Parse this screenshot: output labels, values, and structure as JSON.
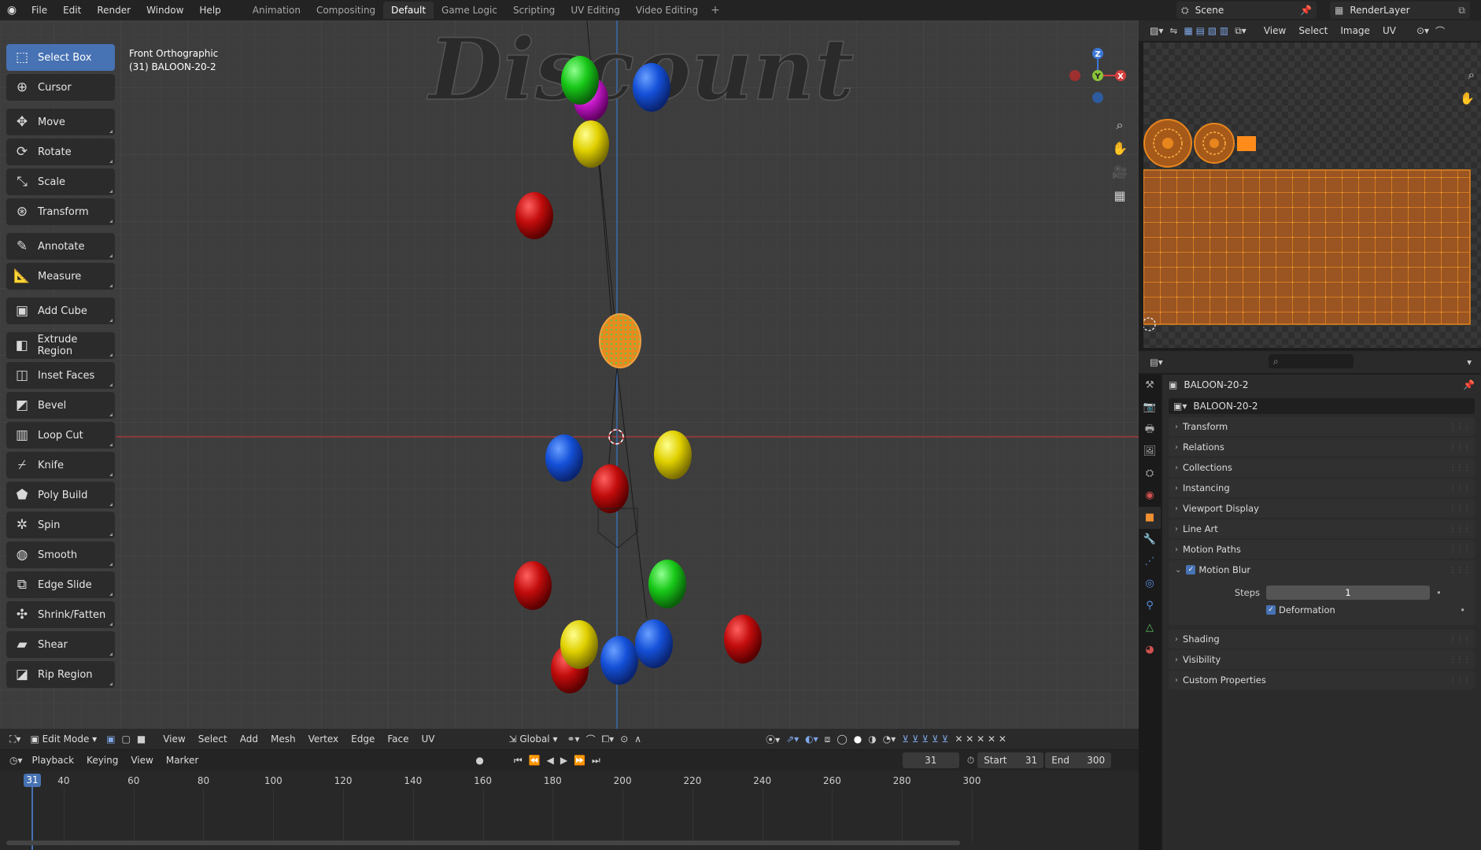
{
  "topbar": {
    "menus": [
      "File",
      "Edit",
      "Render",
      "Window",
      "Help"
    ],
    "workspaces": [
      {
        "label": "Animation",
        "active": false
      },
      {
        "label": "Compositing",
        "active": false
      },
      {
        "label": "Default",
        "active": true
      },
      {
        "label": "Game Logic",
        "active": false
      },
      {
        "label": "Scripting",
        "active": false
      },
      {
        "label": "UV Editing",
        "active": false
      },
      {
        "label": "Video Editing",
        "active": false
      }
    ],
    "add_workspace": "+",
    "scene": "Scene",
    "render_layer": "RenderLayer"
  },
  "viewport": {
    "view_name": "Front Orthographic",
    "object_info": "(31) BALOON-20-2",
    "background_text": "Discount",
    "gizmo": {
      "z": "Z",
      "y": "Y",
      "x": "X"
    }
  },
  "tools": [
    {
      "label": "Select Box",
      "icon": "select-box-icon",
      "glyph": "⬚",
      "active": true
    },
    {
      "label": "Cursor",
      "icon": "cursor-icon",
      "glyph": "⊕",
      "active": false
    },
    {
      "label": "Move",
      "icon": "move-icon",
      "glyph": "✥",
      "active": false
    },
    {
      "label": "Rotate",
      "icon": "rotate-icon",
      "glyph": "⟳",
      "active": false
    },
    {
      "label": "Scale",
      "icon": "scale-icon",
      "glyph": "⤡",
      "active": false
    },
    {
      "label": "Transform",
      "icon": "transform-icon",
      "glyph": "⊛",
      "active": false
    },
    {
      "label": "Annotate",
      "icon": "annotate-icon",
      "glyph": "✎",
      "active": false
    },
    {
      "label": "Measure",
      "icon": "measure-icon",
      "glyph": "📐",
      "active": false
    },
    {
      "label": "Add Cube",
      "icon": "add-cube-icon",
      "glyph": "▣",
      "active": false
    },
    {
      "label": "Extrude Region",
      "icon": "extrude-region-icon",
      "glyph": "◧",
      "active": false
    },
    {
      "label": "Inset Faces",
      "icon": "inset-faces-icon",
      "glyph": "◫",
      "active": false
    },
    {
      "label": "Bevel",
      "icon": "bevel-icon",
      "glyph": "◩",
      "active": false
    },
    {
      "label": "Loop Cut",
      "icon": "loop-cut-icon",
      "glyph": "▥",
      "active": false
    },
    {
      "label": "Knife",
      "icon": "knife-icon",
      "glyph": "⌿",
      "active": false
    },
    {
      "label": "Poly Build",
      "icon": "poly-build-icon",
      "glyph": "⬟",
      "active": false
    },
    {
      "label": "Spin",
      "icon": "spin-icon",
      "glyph": "✲",
      "active": false
    },
    {
      "label": "Smooth",
      "icon": "smooth-icon",
      "glyph": "◍",
      "active": false
    },
    {
      "label": "Edge Slide",
      "icon": "edge-slide-icon",
      "glyph": "⧉",
      "active": false
    },
    {
      "label": "Shrink/Fatten",
      "icon": "shrink-fatten-icon",
      "glyph": "✣",
      "active": false
    },
    {
      "label": "Shear",
      "icon": "shear-icon",
      "glyph": "▰",
      "active": false
    },
    {
      "label": "Rip Region",
      "icon": "rip-region-icon",
      "glyph": "◪",
      "active": false
    }
  ],
  "viewport_header": {
    "mode": "Edit Mode",
    "menus": [
      "View",
      "Select",
      "Add",
      "Mesh",
      "Vertex",
      "Edge",
      "Face",
      "UV"
    ],
    "orientation": "Global"
  },
  "timeline_header": {
    "menus": [
      "Playback",
      "Keying",
      "View",
      "Marker"
    ],
    "current_frame": "31",
    "start_label": "Start",
    "start": "31",
    "end_label": "End",
    "end": "300"
  },
  "timeline": {
    "ticks": [
      "40",
      "60",
      "80",
      "100",
      "120",
      "140",
      "160",
      "180",
      "200",
      "220",
      "240",
      "260",
      "280",
      "300"
    ],
    "current": "31"
  },
  "uv_editor": {
    "menus": [
      "View",
      "Select",
      "Image",
      "UV"
    ]
  },
  "properties": {
    "search_placeholder": "",
    "object_name": "BALOON-20-2",
    "data_name": "BALOON-20-2",
    "sections": [
      "Transform",
      "Relations",
      "Collections",
      "Instancing",
      "Viewport Display",
      "Line Art",
      "Motion Paths"
    ],
    "motion_blur": {
      "label": "Motion Blur",
      "steps_label": "Steps",
      "steps": "1",
      "deformation_label": "Deformation"
    },
    "sections_after": [
      "Shading",
      "Visibility",
      "Custom Properties"
    ]
  },
  "colors": {
    "accent": "#4772b3",
    "viewport_bg": "#3d3d3d",
    "selection_orange": "#e8821e",
    "x_axis": "#d33e3e",
    "y_axis": "#8bc33a",
    "z_axis": "#3c78d8"
  }
}
